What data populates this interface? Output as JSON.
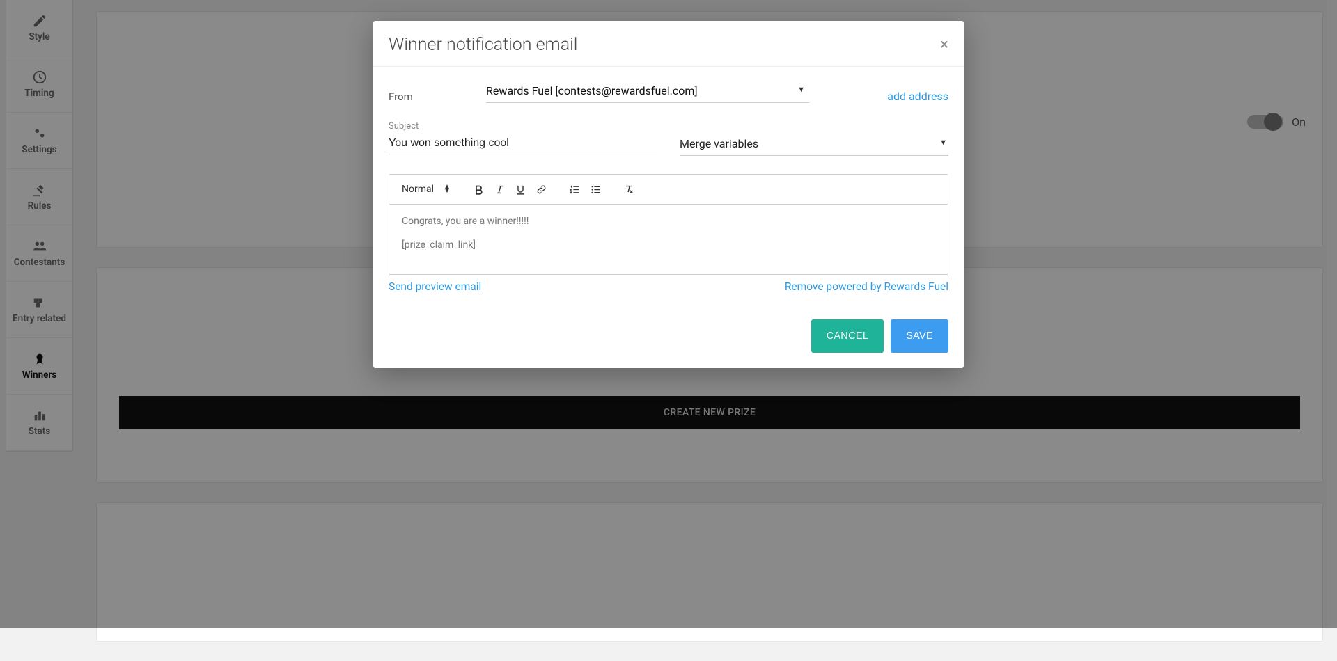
{
  "sidebar": {
    "items": [
      {
        "label": "Style"
      },
      {
        "label": "Timing"
      },
      {
        "label": "Settings"
      },
      {
        "label": "Rules"
      },
      {
        "label": "Contestants"
      },
      {
        "label": "Entry related"
      },
      {
        "label": "Winners"
      },
      {
        "label": "Stats"
      }
    ]
  },
  "background": {
    "toggle_label": "On",
    "create_prize_label": "CREATE NEW PRIZE"
  },
  "modal": {
    "title": "Winner notification email",
    "from_label": "From",
    "from_value": "Rewards Fuel [contests@rewardsfuel.com]",
    "add_address": "add address",
    "subject_label": "Subject",
    "subject_value": "You won something cool",
    "merge_label": "Merge variables",
    "editor": {
      "format_label": "Normal",
      "body_line1": "Congrats, you are a winner!!!!!",
      "body_line2": "[prize_claim_link]"
    },
    "send_preview": "Send preview email",
    "remove_powered": "Remove powered by Rewards Fuel",
    "cancel": "CANCEL",
    "save": "SAVE"
  }
}
